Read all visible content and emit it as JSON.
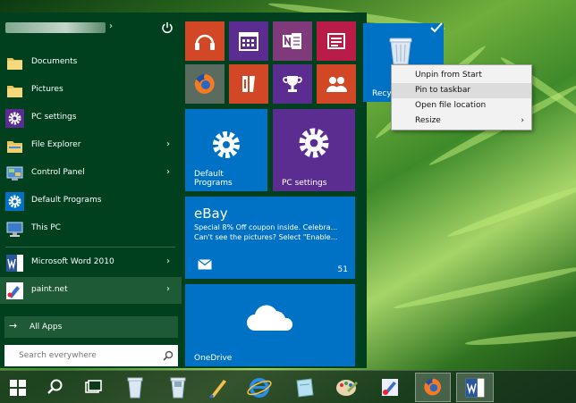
{
  "colors": {
    "start_menu_bg": "#00401f",
    "tile_orange": "#d24726",
    "tile_purple": "#5c2d91",
    "tile_magenta": "#b91d47",
    "tile_blue": "#0072c6",
    "taskbar": "#14301c"
  },
  "user": {
    "chevron": "›"
  },
  "left_menu": {
    "items": [
      {
        "label": "Documents",
        "icon": "folder-icon"
      },
      {
        "label": "Pictures",
        "icon": "folder-icon"
      },
      {
        "label": "PC settings",
        "icon": "gear-icon"
      },
      {
        "label": "File Explorer",
        "icon": "folder-icon",
        "arrow": "›"
      },
      {
        "label": "Control Panel",
        "icon": "control-panel-icon",
        "arrow": "›"
      },
      {
        "label": "Default Programs",
        "icon": "gear-icon"
      },
      {
        "label": "This PC",
        "icon": "computer-icon"
      },
      {
        "label": "Microsoft Word 2010",
        "icon": "word-icon",
        "arrow": "›"
      },
      {
        "label": "paint.net",
        "icon": "paint-icon",
        "arrow": "›"
      }
    ],
    "all_apps": {
      "arrow": "→",
      "label": "All Apps"
    },
    "search": {
      "placeholder": "Search everywhere"
    }
  },
  "tiles": {
    "default_programs": "Default Programs",
    "pc_settings": "PC settings",
    "recycle_bin": "Recyc",
    "ebay": {
      "title": "eBay",
      "text": "Special 8% Off coupon inside. Celebra... Can't see the pictures? Select \"Enable...",
      "count": "51"
    },
    "onedrive": "OneDrive"
  },
  "context_menu": {
    "items": [
      {
        "label": "Unpin from Start"
      },
      {
        "label": "Pin to taskbar",
        "selected": true
      },
      {
        "label": "Open file location"
      },
      {
        "label": "Resize",
        "arrow": "›"
      }
    ]
  }
}
